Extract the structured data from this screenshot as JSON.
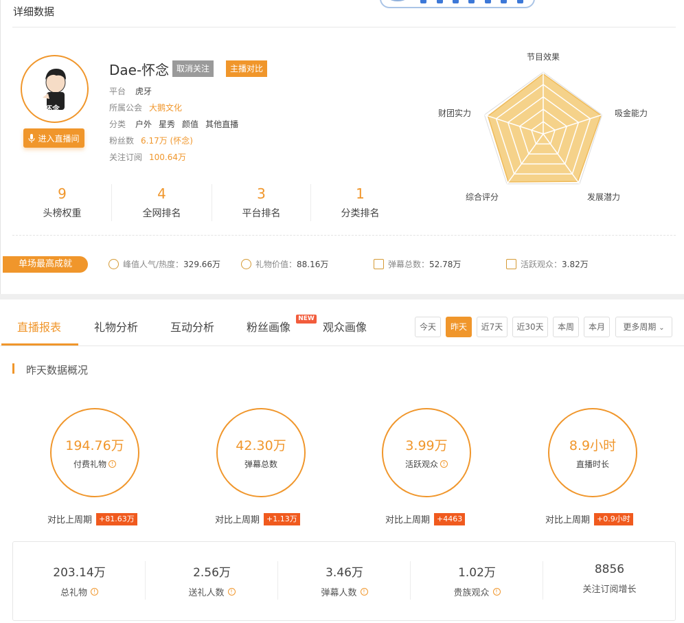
{
  "header": {
    "title": "详细数据"
  },
  "profile": {
    "name": "Dae-怀念",
    "unfollow_label": "取消关注",
    "compare_label": "主播对比",
    "enter_live_label": "进入直播间",
    "avatar_caption": "怀念",
    "platform_label": "平台",
    "platform_value": "虎牙",
    "guild_label": "所属公会",
    "guild_value": "大鹅文化",
    "category_label": "分类",
    "categories": [
      "户外",
      "星秀",
      "颜值",
      "其他直播"
    ],
    "fans_label": "粉丝数",
    "fans_value": "6.17万 (怀念)",
    "subs_label": "关注订阅",
    "subs_value": "100.64万"
  },
  "rank_stats": [
    {
      "value": "9",
      "label": "头榜权重"
    },
    {
      "value": "4",
      "label": "全网排名"
    },
    {
      "value": "3",
      "label": "平台排名"
    },
    {
      "value": "1",
      "label": "分类排名"
    }
  ],
  "radar": {
    "labels": [
      "节目效果",
      "吸金能力",
      "发展潜力",
      "综合评分",
      "财团实力"
    ],
    "values": [
      0.97,
      0.98,
      0.95,
      0.96,
      0.94
    ],
    "colors": {
      "fill": "#f5d28a",
      "stroke": "#efbb5a",
      "grid": "#ffffff",
      "outer": "#dcdcdc"
    }
  },
  "best": {
    "label": "单场最高成就",
    "metrics": [
      {
        "label": "峰值人气/热度：",
        "value": "329.66万",
        "icon": "magnify-person-icon"
      },
      {
        "label": "礼物价值：",
        "value": "88.16万",
        "icon": "coin-icon"
      },
      {
        "label": "弹幕总数：",
        "value": "52.78万",
        "icon": "list-icon"
      },
      {
        "label": "活跃观众：",
        "value": "3.82万",
        "icon": "wave-icon"
      }
    ]
  },
  "tabs": {
    "items": [
      "直播报表",
      "礼物分析",
      "互动分析",
      "粉丝画像",
      "观众画像"
    ],
    "new_badge": "NEW",
    "ranges": [
      "今天",
      "昨天",
      "近7天",
      "近30天",
      "本周",
      "本月"
    ],
    "more_label": "更多周期",
    "active_range": "昨天"
  },
  "overview": {
    "title": "昨天数据概况",
    "circles": [
      {
        "value": "194.76万",
        "label": "付费礼物",
        "info": true,
        "cmp_label": "对比上周期",
        "delta": "+81.63万"
      },
      {
        "value": "42.30万",
        "label": "弹幕总数",
        "info": false,
        "cmp_label": "对比上周期",
        "delta": "+1.13万"
      },
      {
        "value": "3.99万",
        "label": "活跃观众",
        "info": true,
        "cmp_label": "对比上周期",
        "delta": "+4463"
      },
      {
        "value": "8.9小时",
        "label": "直播时长",
        "info": false,
        "cmp_label": "对比上周期",
        "delta": "+0.9小时"
      }
    ],
    "summary": [
      {
        "value": "203.14万",
        "label": "总礼物"
      },
      {
        "value": "2.56万",
        "label": "送礼人数"
      },
      {
        "value": "3.46万",
        "label": "弹幕人数"
      },
      {
        "value": "1.02万",
        "label": "贵族观众"
      },
      {
        "value": "8856",
        "label": "关注订阅增长"
      }
    ]
  },
  "colors": {
    "accent": "#f0962b",
    "delta_bg": "#f05a1e",
    "new_badge": "#f25c3c"
  }
}
